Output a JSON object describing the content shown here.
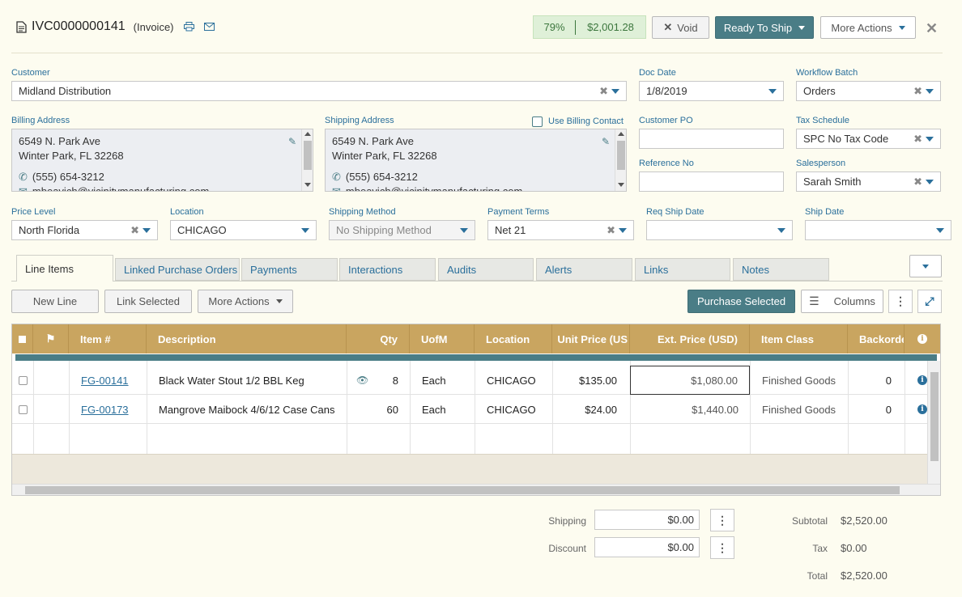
{
  "header": {
    "doc_id": "IVC0000000141",
    "doc_type": "(Invoice)",
    "progress_pct": "79%",
    "progress_amount": "$2,001.28",
    "void_label": "Void",
    "ready_label": "Ready To Ship",
    "more_actions_label": "More Actions"
  },
  "form": {
    "customer_label": "Customer",
    "customer_value": "Midland Distribution",
    "doc_date_label": "Doc Date",
    "doc_date_value": "1/8/2019",
    "workflow_label": "Workflow Batch",
    "workflow_value": "Orders",
    "billing_label": "Billing Address",
    "billing_lines": [
      "6549 N. Park Ave",
      "Winter Park, FL 32268",
      "(555) 654-3212",
      "mbeavich@vicinitymanufacturing.com"
    ],
    "shipping_label": "Shipping Address",
    "use_billing_label": "Use Billing Contact",
    "shipping_lines": [
      "6549 N. Park Ave",
      "Winter Park, FL 32268",
      "(555) 654-3212",
      "mbeavich@vicinitymanufacturing.com"
    ],
    "customer_po_label": "Customer PO",
    "customer_po_value": "",
    "reference_label": "Reference No",
    "reference_value": "",
    "tax_label": "Tax Schedule",
    "tax_value": "SPC No Tax Code",
    "salesperson_label": "Salesperson",
    "salesperson_value": "Sarah Smith",
    "price_level_label": "Price Level",
    "price_level_value": "North Florida",
    "location_label": "Location",
    "location_value": "CHICAGO",
    "ship_method_label": "Shipping Method",
    "ship_method_value": "No Shipping Method",
    "terms_label": "Payment Terms",
    "terms_value": "Net 21",
    "req_ship_label": "Req Ship Date",
    "req_ship_value": "",
    "ship_date_label": "Ship Date",
    "ship_date_value": ""
  },
  "tabs": [
    "Line Items",
    "Linked Purchase Orders",
    "Payments",
    "Interactions",
    "Audits",
    "Alerts",
    "Links",
    "Notes"
  ],
  "toolbar": {
    "new_line": "New Line",
    "link_selected": "Link Selected",
    "more_actions": "More Actions",
    "purchase_selected": "Purchase Selected",
    "columns": "Columns"
  },
  "grid": {
    "columns": [
      "Item #",
      "Description",
      "Qty",
      "UofM",
      "Location",
      "Unit Price (US",
      "Ext. Price (USD)",
      "Item Class",
      "Backorde"
    ],
    "rows": [
      {
        "item": "FG-00141",
        "description": "Black Water Stout 1/2 BBL Keg",
        "qty": "8",
        "uofm": "Each",
        "location": "CHICAGO",
        "unit_price": "$135.00",
        "ext_price": "$1,080.00",
        "item_class": "Finished Goods",
        "backorder": "0"
      },
      {
        "item": "FG-00173",
        "description": "Mangrove Maibock 4/6/12 Case Cans",
        "qty": "60",
        "uofm": "Each",
        "location": "CHICAGO",
        "unit_price": "$24.00",
        "ext_price": "$1,440.00",
        "item_class": "Finished Goods",
        "backorder": "0"
      }
    ]
  },
  "totals": {
    "shipping_label": "Shipping",
    "shipping_value": "$0.00",
    "discount_label": "Discount",
    "discount_value": "$0.00",
    "subtotal_label": "Subtotal",
    "subtotal_value": "$2,520.00",
    "tax_label": "Tax",
    "tax_value": "$0.00",
    "total_label": "Total",
    "total_value": "$2,520.00"
  },
  "colors": {
    "accent": "#2a6f9b",
    "teal": "#4a7d86",
    "grid_header": "#c9a560",
    "background": "#fdfcf0"
  }
}
